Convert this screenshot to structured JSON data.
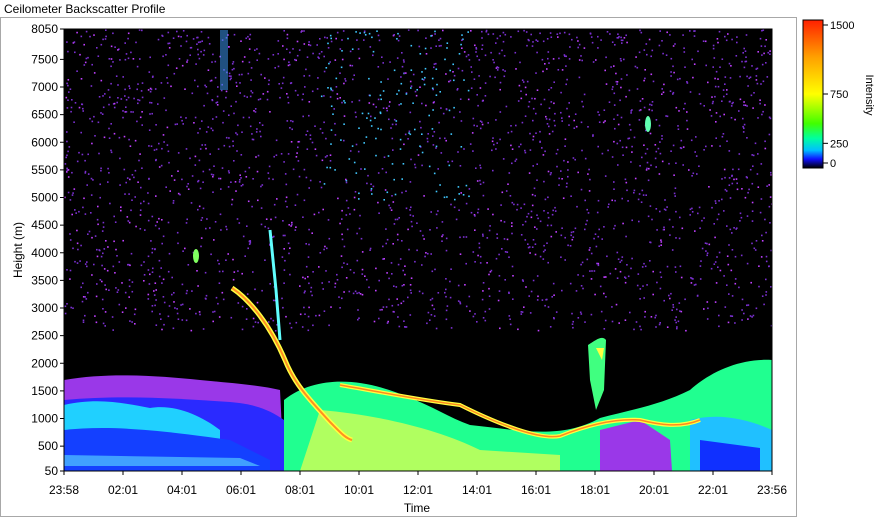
{
  "window": {
    "title": "Ceilometer Backscatter Profile"
  },
  "chart_data": {
    "type": "heatmap",
    "title": "Ceilometer Backscatter Profile",
    "xlabel": "Time",
    "ylabel": "Height (m)",
    "x_ticks": [
      "23:58",
      "02:01",
      "04:01",
      "06:01",
      "08:01",
      "10:01",
      "12:01",
      "14:01",
      "16:01",
      "18:01",
      "20:01",
      "22:01",
      "23:56"
    ],
    "y_ticks": [
      50,
      500,
      1000,
      1500,
      2000,
      2500,
      3000,
      3500,
      4000,
      4500,
      5000,
      5500,
      6000,
      6500,
      7000,
      7500,
      8050
    ],
    "ylim": [
      50,
      8050
    ],
    "colorbar": {
      "label": "Intensity",
      "ticks": [
        1500,
        750,
        250,
        0
      ],
      "range": [
        0,
        1500
      ],
      "colors": [
        "#000000",
        "#1010ff",
        "#00c0ff",
        "#00ffa0",
        "#40ff00",
        "#ffff00",
        "#ffa000",
        "#ff2000"
      ]
    },
    "features": [
      {
        "name": "boundary_layer_aerosol",
        "time_range": [
          "23:58",
          "07:30"
        ],
        "top_height": 1600,
        "intensity": 150
      },
      {
        "name": "boundary_layer_aerosol",
        "time_range": [
          "07:45",
          "23:56"
        ],
        "top_height": 1400,
        "intensity": 400
      },
      {
        "name": "descending_cloud_layer",
        "time_range": [
          "05:50",
          "09:30"
        ],
        "height_range": [
          3400,
          900
        ],
        "intensity": 1100
      },
      {
        "name": "mixing_layer_top",
        "time_range": [
          "09:30",
          "20:30"
        ],
        "height_range": [
          1100,
          700
        ],
        "intensity": 900
      },
      {
        "name": "elevated_layer",
        "time_range": [
          "17:50",
          "18:20"
        ],
        "height_range": [
          1400,
          2500
        ],
        "intensity": 700
      },
      {
        "name": "cloud_patch",
        "time": "04:45",
        "height": 4000,
        "intensity": 500
      },
      {
        "name": "cloud_patch",
        "time": "19:50",
        "height": 6400,
        "intensity": 600
      },
      {
        "name": "background_noise",
        "time_range": [
          "23:58",
          "23:56"
        ],
        "height_range": [
          2000,
          8050
        ],
        "intensity": 80
      }
    ]
  }
}
